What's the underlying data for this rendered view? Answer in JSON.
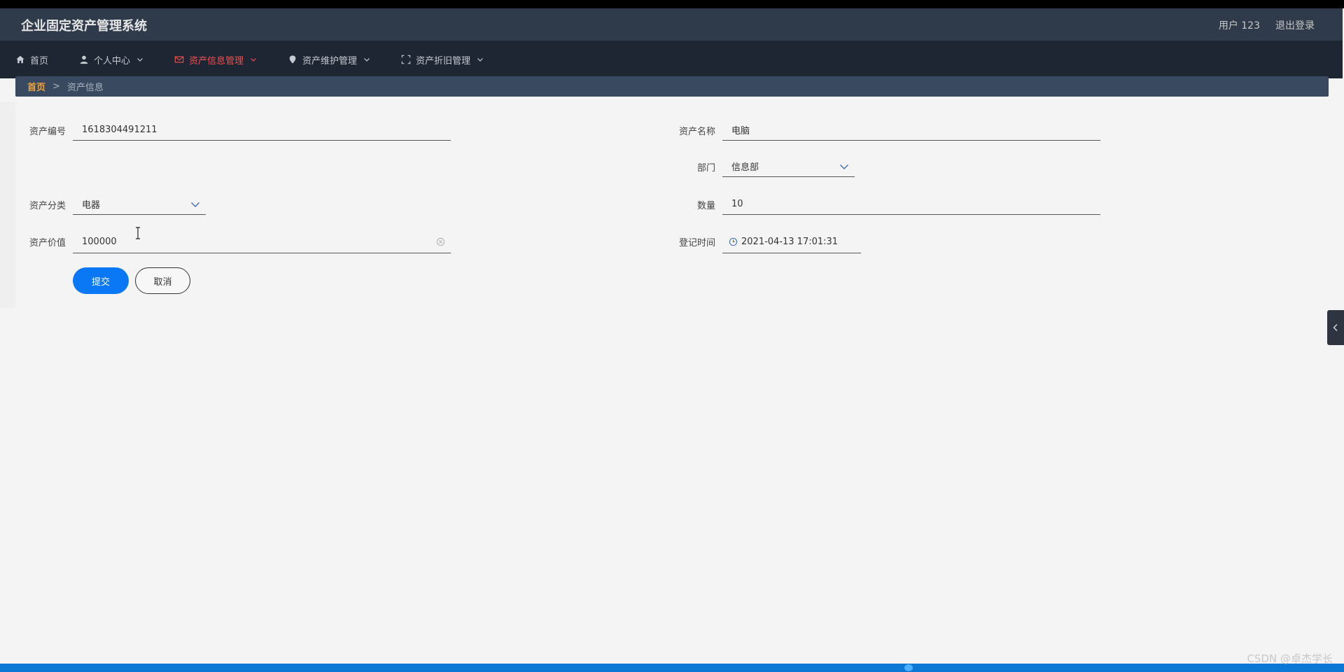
{
  "header": {
    "app_title": "企业固定资产管理系统",
    "user_label": "用户 123",
    "logout_label": "退出登录"
  },
  "nav": {
    "items": [
      {
        "label": "首页",
        "icon": "home-icon",
        "has_caret": false
      },
      {
        "label": "个人中心",
        "icon": "user-icon",
        "has_caret": true
      },
      {
        "label": "资产信息管理",
        "icon": "mail-icon",
        "has_caret": true,
        "active": true
      },
      {
        "label": "资产维护管理",
        "icon": "location-icon",
        "has_caret": true
      },
      {
        "label": "资产折旧管理",
        "icon": "fullscreen-icon",
        "has_caret": true
      }
    ]
  },
  "breadcrumb": {
    "home": "首页",
    "separator": ">",
    "current": "资产信息"
  },
  "form": {
    "asset_code_label": "资产编号",
    "asset_code_value": "1618304491211",
    "asset_name_label": "资产名称",
    "asset_name_value": "电脑",
    "department_label": "部门",
    "department_value": "信息部",
    "category_label": "资产分类",
    "category_value": "电器",
    "quantity_label": "数量",
    "quantity_value": "10",
    "value_label": "资产价值",
    "value_value": "100000",
    "register_time_label": "登记时间",
    "register_time_value": "2021-04-13 17:01:31",
    "submit_label": "提交",
    "cancel_label": "取消"
  },
  "watermark": "CSDN @卓杰学长",
  "colors": {
    "topbar": "#2f3a4a",
    "navbar": "#1e2533",
    "active_nav": "#f0504f",
    "breadcrumb_bg": "#394a60",
    "breadcrumb_home": "#f2a23a",
    "primary_button": "#0a78f5"
  }
}
